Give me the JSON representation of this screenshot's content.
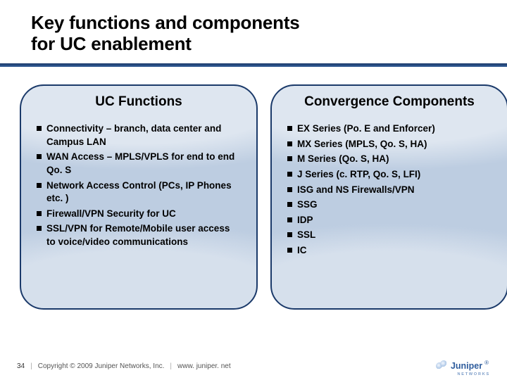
{
  "title_line1": "Key functions and components",
  "title_line2": "for UC enablement",
  "left": {
    "heading": "UC Functions",
    "items": [
      "Connectivity – branch, data center and Campus LAN",
      "WAN Access – MPLS/VPLS for end to end Qo. S",
      "Network Access Control (PCs, IP Phones etc. )",
      "Firewall/VPN Security for UC",
      "SSL/VPN for Remote/Mobile user access to voice/video communications"
    ]
  },
  "right": {
    "heading": "Convergence Components",
    "items": [
      "EX Series (Po. E and Enforcer)",
      "MX Series (MPLS, Qo. S, HA)",
      "M Series (Qo. S, HA)",
      "J Series (c. RTP, Qo. S, LFI)",
      "ISG and NS Firewalls/VPN",
      "SSG",
      "IDP",
      "SSL",
      "IC"
    ]
  },
  "footer": {
    "page": "34",
    "copyright": "Copyright © 2009 Juniper Networks, Inc.",
    "url": "www. juniper. net",
    "logo_text": "Juniper",
    "logo_reg": "®",
    "logo_sub": "NETWORKS"
  }
}
